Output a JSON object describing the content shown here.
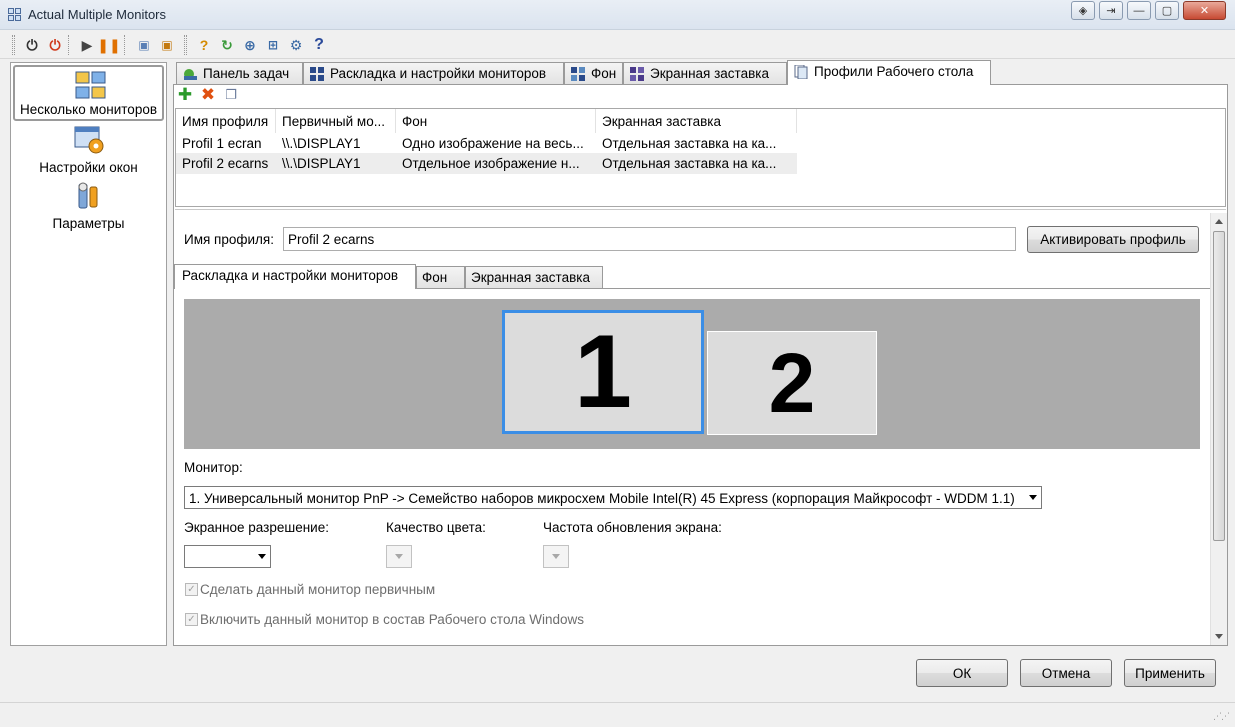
{
  "window": {
    "title": "Actual Multiple Monitors"
  },
  "toolbar": {
    "icons": [
      "power-icon",
      "stop-icon",
      "play-icon",
      "pause-icon",
      "hotkey-icon",
      "profile-switch-icon",
      "help-icon",
      "refresh-icon",
      "web-icon",
      "monitors-icon",
      "settings-icon",
      "question-icon"
    ]
  },
  "leftnav": {
    "items": [
      {
        "label": "Несколько мониторов",
        "icon": "multi-monitor-icon"
      },
      {
        "label": "Настройки окон",
        "icon": "window-settings-icon"
      },
      {
        "label": "Параметры",
        "icon": "tools-icon"
      }
    ]
  },
  "tabs": [
    {
      "label": "Панель задач"
    },
    {
      "label": "Раскладка и настройки мониторов"
    },
    {
      "label": "Фон"
    },
    {
      "label": "Экранная заставка"
    },
    {
      "label": "Профили Рабочего стола"
    }
  ],
  "profiles": {
    "columns": [
      "Имя профиля",
      "Первичный мо...",
      "Фон",
      "Экранная заставка"
    ],
    "rows": [
      [
        "Profil 1 ecran",
        "\\\\.\\DISPLAY1",
        "Одно изображение на весь...",
        "Отдельная заставка на ка..."
      ],
      [
        "Profil 2 ecarns",
        "\\\\.\\DISPLAY1",
        "Отдельное изображение н...",
        "Отдельная заставка на ка..."
      ]
    ]
  },
  "editor": {
    "profile_name_label": "Имя профиля:",
    "profile_name_value": "Profil 2 ecarns",
    "activate_button": "Активировать профиль",
    "subtabs": [
      "Раскладка и настройки мониторов",
      "Фон",
      "Экранная заставка"
    ],
    "monitors": [
      "1",
      "2"
    ],
    "monitor_label": "Монитор:",
    "monitor_value": "1. Универсальный монитор PnP -> Семейство наборов микросхем Mobile Intel(R) 45 Express (корпорация Майкрософт - WDDM 1.1)",
    "resolution_label": "Экранное разрешение:",
    "color_label": "Качество цвета:",
    "refresh_label": "Частота обновления экрана:",
    "primary_checkbox": "Сделать данный монитор первичным",
    "include_checkbox": "Включить данный монитор в состав Рабочего стола Windows"
  },
  "dialog": {
    "ok": "ОК",
    "cancel": "Отмена",
    "apply": "Применить"
  },
  "colors": {
    "selected_monitor_border": "#3b8ee6",
    "monitor_area_bg": "#ababab"
  }
}
